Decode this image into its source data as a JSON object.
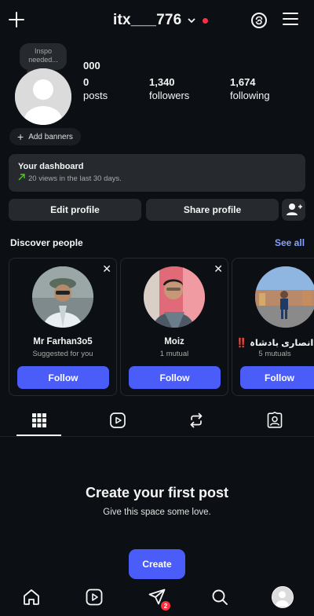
{
  "header": {
    "username": "itx___776",
    "chevron": "⌄"
  },
  "profile": {
    "note": "Inspo needed...",
    "display_name": "000",
    "stats": [
      {
        "value": "0",
        "label": "posts"
      },
      {
        "value": "1,340",
        "label": "followers"
      },
      {
        "value": "1,674",
        "label": "following"
      }
    ],
    "add_banners": "Add banners"
  },
  "dashboard": {
    "title": "Your dashboard",
    "subtitle": "20 views in the last 30 days."
  },
  "actions": {
    "edit_profile": "Edit profile",
    "share_profile": "Share profile"
  },
  "discover": {
    "title": "Discover people",
    "see_all": "See all",
    "cards": [
      {
        "name": "Mr Farhan3o5",
        "subtitle": "Suggested for you",
        "follow": "Follow"
      },
      {
        "name": "Moiz",
        "subtitle": "1 mutual",
        "follow": "Follow"
      },
      {
        "name": "انصاری بادشاہ",
        "prefix": "‼️",
        "subtitle": "5 mutuals",
        "follow": "Follow"
      }
    ]
  },
  "empty_state": {
    "title": "Create your first post",
    "subtitle": "Give this space some love.",
    "create": "Create"
  },
  "nav": {
    "badge_count": "2"
  },
  "colors": {
    "background": "#0c1014",
    "surface": "#262a2f",
    "accent": "#4a5df9",
    "link": "#85a1ff",
    "notification": "#ff3040"
  }
}
